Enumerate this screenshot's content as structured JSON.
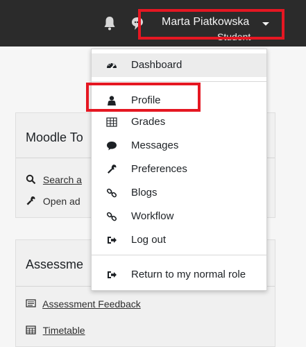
{
  "topbar": {
    "user_name": "Marta Piatkowska",
    "user_role": "Student",
    "icons": [
      "bell-icon",
      "chat-icon"
    ]
  },
  "dropdown": {
    "items": [
      {
        "label": "Dashboard",
        "icon": "dashboard-icon",
        "active": true
      },
      {
        "label": "Profile",
        "icon": "user-icon",
        "highlighted": true
      },
      {
        "label": "Grades",
        "icon": "table-icon"
      },
      {
        "label": "Messages",
        "icon": "comment-icon"
      },
      {
        "label": "Preferences",
        "icon": "wrench-icon"
      },
      {
        "label": "Blogs",
        "icon": "link-icon"
      },
      {
        "label": "Workflow",
        "icon": "link-icon"
      },
      {
        "label": "Log out",
        "icon": "sign-out-icon"
      },
      {
        "label": "Return to my normal role",
        "icon": "sign-out-icon"
      }
    ]
  },
  "blocks": {
    "tools": {
      "title": "Moodle To",
      "items": [
        {
          "label": "Search a",
          "icon": "search-icon"
        },
        {
          "label": "Open ad",
          "icon": "wrench-icon"
        }
      ]
    },
    "assessment": {
      "title": "Assessme",
      "items": [
        {
          "label": "Assessment Feedback",
          "icon": "feedback-icon"
        },
        {
          "label": "Timetable",
          "icon": "calendar-icon"
        }
      ]
    }
  },
  "colors": {
    "topbar": "#2b2b2b",
    "highlight": "#e51722",
    "dropdown_active": "#ececec"
  }
}
